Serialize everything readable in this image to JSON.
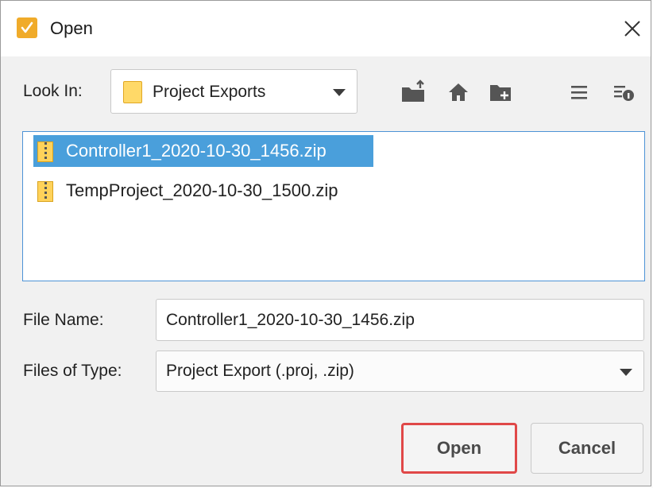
{
  "window": {
    "title": "Open"
  },
  "look_in": {
    "label": "Look In:",
    "value": "Project Exports"
  },
  "toolbar": {
    "icons": [
      "folder-up-icon",
      "home-icon",
      "new-folder-icon",
      "list-view-icon",
      "details-view-icon"
    ]
  },
  "files": [
    {
      "name": "Controller1_2020-10-30_1456.zip",
      "selected": true
    },
    {
      "name": "TempProject_2020-10-30_1500.zip",
      "selected": false
    }
  ],
  "file_name": {
    "label": "File Name:",
    "value": "Controller1_2020-10-30_1456.zip"
  },
  "files_of_type": {
    "label": "Files of Type:",
    "value": "Project Export (.proj, .zip)"
  },
  "buttons": {
    "open": "Open",
    "cancel": "Cancel"
  },
  "colors": {
    "selection": "#4a9fdb",
    "highlight_border": "#e04848",
    "list_border": "#4d93d6",
    "app_icon": "#f0ab2a"
  }
}
